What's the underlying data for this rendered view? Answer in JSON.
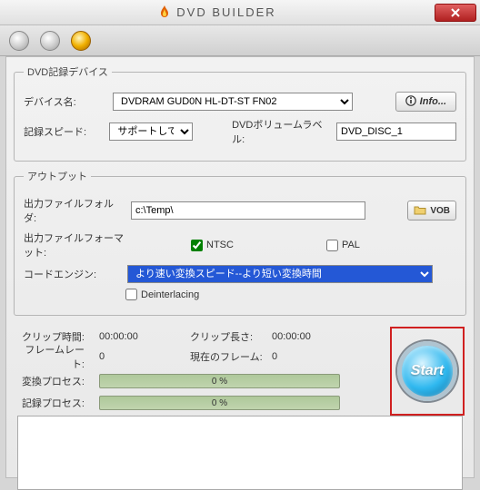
{
  "window": {
    "title": "DVD BUILDER"
  },
  "device_group": {
    "legend": "DVD記録デバイス",
    "device_name_label": "デバイス名:",
    "device_name_value": "DVDRAM GUD0N    HL-DT-ST FN02",
    "speed_label": "記録スピード:",
    "speed_value": "サポートしていま",
    "volume_label": "DVDボリュームラベル:",
    "volume_value": "DVD_DISC_1",
    "info_btn": "Info..."
  },
  "output_group": {
    "legend": "アウトプット",
    "folder_label": "出力ファイルフォルダ:",
    "folder_value": "c:\\Temp\\",
    "vob_btn": "VOB",
    "format_label": "出力ファイルフォーマット:",
    "ntsc": "NTSC",
    "pal": "PAL",
    "ntsc_checked": true,
    "pal_checked": false,
    "engine_label": "コードエンジン:",
    "engine_value": "より速い変換スピード--より短い変換時間",
    "deinterlace": "Deinterlacing",
    "deinterlace_checked": false
  },
  "stats": {
    "clip_time_label": "クリップ時間:",
    "clip_time_value": "00:00:00",
    "clip_len_label": "クリップ長さ:",
    "clip_len_value": "00:00:00",
    "fps_label": "フレームレート:",
    "fps_value": "0",
    "cur_frame_label": "現在のフレーム:",
    "cur_frame_value": "0",
    "convert_label": "変換プロセス:",
    "convert_pct": "0 %",
    "record_label": "記録プロセス:",
    "record_pct": "0 %",
    "start_btn": "Start"
  }
}
